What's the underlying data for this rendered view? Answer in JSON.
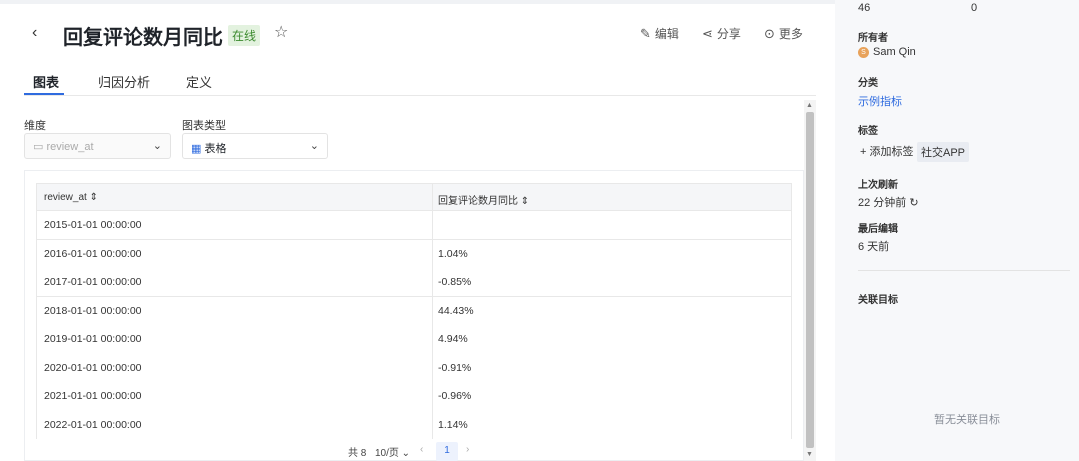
{
  "header": {
    "title": "回复评论数月同比",
    "status": "在线",
    "edit_label": "编辑",
    "share_label": "分享",
    "more_label": "更多"
  },
  "tabs": [
    {
      "label": "图表",
      "active": true
    },
    {
      "label": "归因分析",
      "active": false
    },
    {
      "label": "定义",
      "active": false
    }
  ],
  "filters": {
    "dimension_label": "维度",
    "dimension_placeholder": "review_at",
    "chart_type_label": "图表类型",
    "chart_type_value": "表格"
  },
  "table": {
    "columns": [
      "review_at",
      "回复评论数月同比"
    ],
    "rows": [
      [
        "2015-01-01 00:00:00",
        ""
      ],
      [
        "2016-01-01 00:00:00",
        "1.04%"
      ],
      [
        "2017-01-01 00:00:00",
        "-0.85%"
      ],
      [
        "2018-01-01 00:00:00",
        "44.43%"
      ],
      [
        "2019-01-01 00:00:00",
        "4.94%"
      ],
      [
        "2020-01-01 00:00:00",
        "-0.91%"
      ],
      [
        "2021-01-01 00:00:00",
        "-0.96%"
      ],
      [
        "2022-01-01 00:00:00",
        "1.14%"
      ]
    ]
  },
  "pagination": {
    "total_text": "共 8",
    "page_size": "10/页",
    "current_page": "1"
  },
  "sidebar": {
    "top_value_left": "46",
    "top_value_right": "0",
    "owner_label": "所有者",
    "owner_initial": "S",
    "owner_name": "Sam Qin",
    "category_label": "分类",
    "category_value": "示例指标",
    "tags_label": "标签",
    "add_tag_label": "+ 添加标签",
    "tag_chip": "社交APP",
    "last_update_label": "上次刷新",
    "last_update_value": "22 分钟前",
    "last_edit_label": "最后编辑",
    "last_edit_value": "6 天前",
    "related_label": "关联目标",
    "empty_text": "暂无关联目标"
  },
  "colors": {
    "accent": "#2f6bdf",
    "status_bg": "#e3f2df",
    "status_text": "#3c8b2f"
  }
}
